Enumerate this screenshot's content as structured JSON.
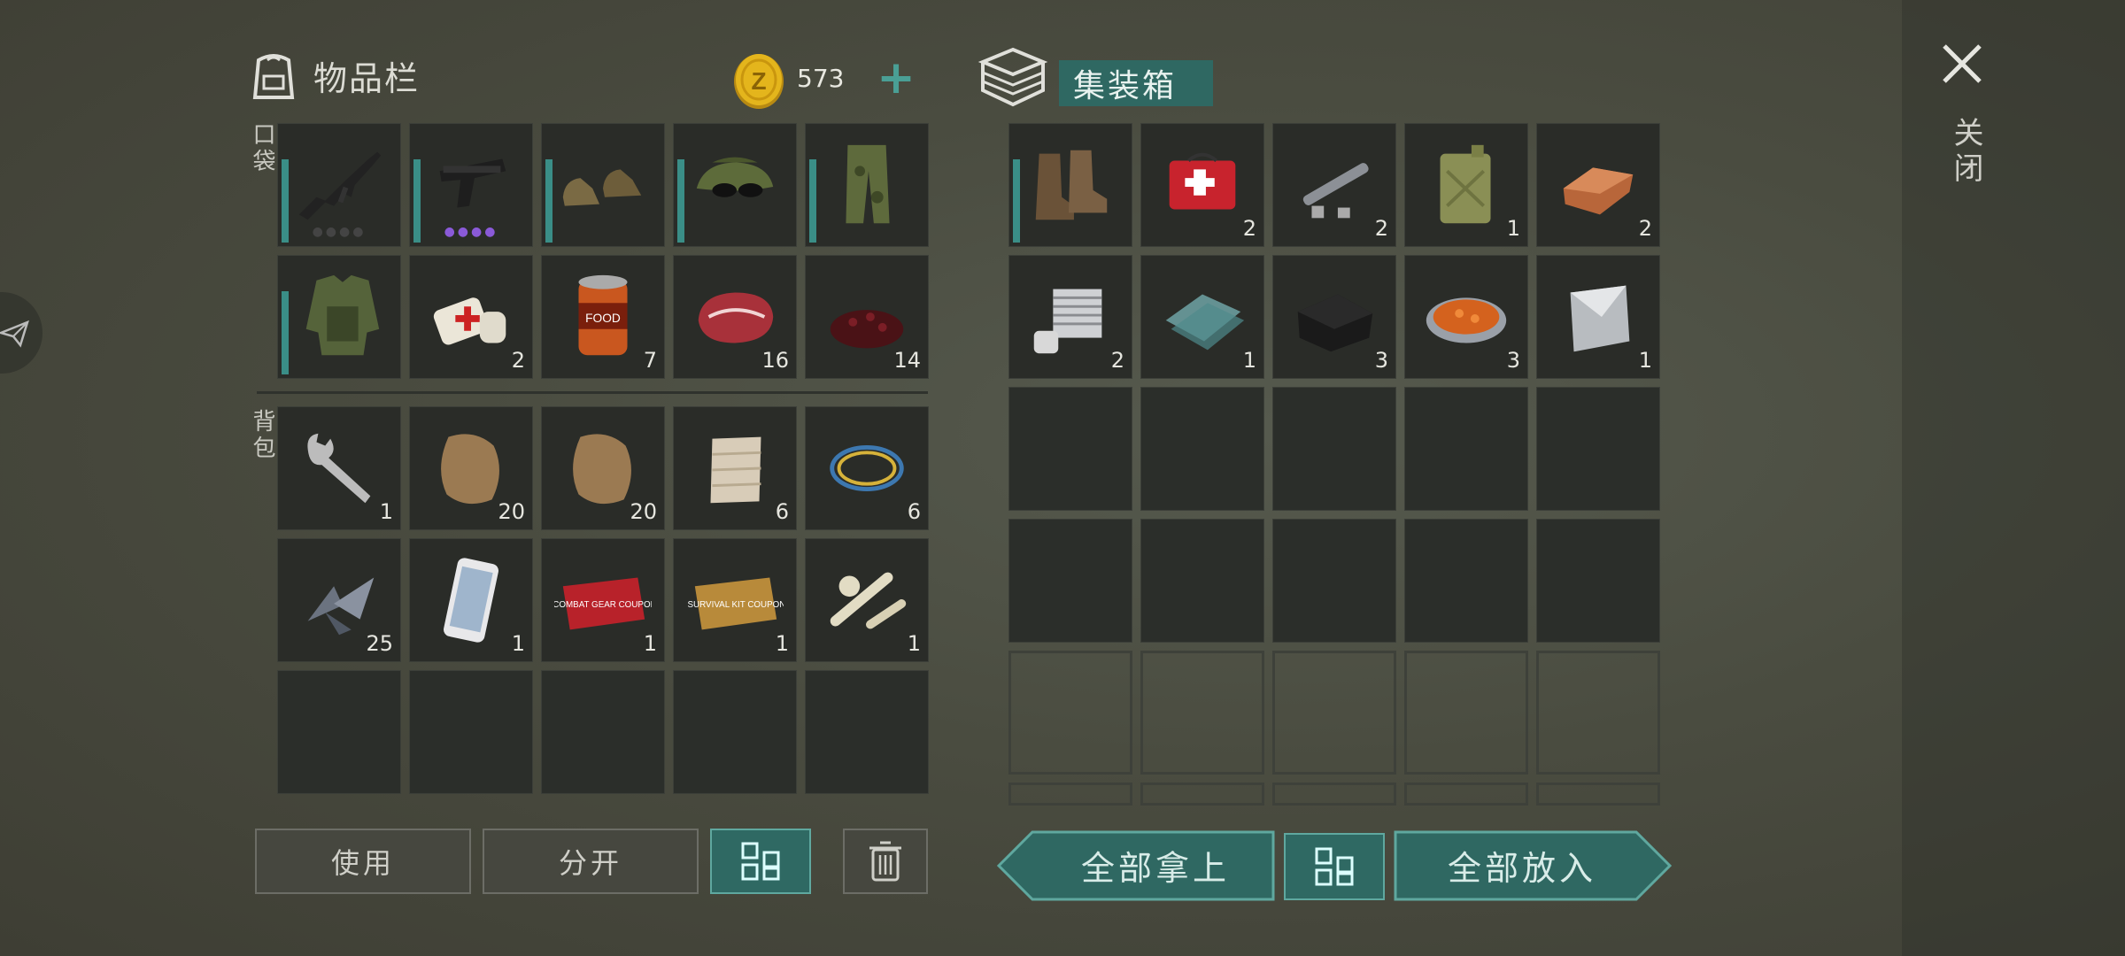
{
  "inventory": {
    "title": "物品栏",
    "coins": "573",
    "pocket_label": "口袋",
    "backpack_label": "背包"
  },
  "container": {
    "title": "集装箱"
  },
  "close_label": "关闭",
  "buttons": {
    "use": "使用",
    "split": "分开",
    "take_all": "全部拿上",
    "put_all": "全部放入"
  },
  "pocket_items": [
    {
      "icon": "assault-rifle",
      "qty": "",
      "bar": true,
      "dots": "grey"
    },
    {
      "icon": "pistol",
      "qty": "",
      "bar": true,
      "dots": "purple"
    },
    {
      "icon": "leather-shoes",
      "qty": "",
      "bar": true
    },
    {
      "icon": "camo-hat-sunglasses",
      "qty": "",
      "bar": true
    },
    {
      "icon": "camo-pants",
      "qty": "",
      "bar": true
    },
    {
      "icon": "camo-jacket",
      "qty": "",
      "bar": true
    },
    {
      "icon": "bandage",
      "qty": "2"
    },
    {
      "icon": "canned-food",
      "qty": "7"
    },
    {
      "icon": "raw-meat",
      "qty": "16"
    },
    {
      "icon": "berries",
      "qty": "14"
    }
  ],
  "backpack_items": [
    {
      "icon": "wrench",
      "qty": "1"
    },
    {
      "icon": "fur-pelt",
      "qty": "20"
    },
    {
      "icon": "fur-pelt",
      "qty": "20"
    },
    {
      "icon": "rope-fabric",
      "qty": "6"
    },
    {
      "icon": "wire-coil",
      "qty": "6"
    },
    {
      "icon": "metal-shards",
      "qty": "25"
    },
    {
      "icon": "smartphone",
      "qty": "1"
    },
    {
      "icon": "combat-gear-coupon",
      "qty": "1",
      "text": "COMBAT GEAR COUPON"
    },
    {
      "icon": "survival-kit-coupon",
      "qty": "1",
      "text": "SURVIVAL KIT COUPON"
    },
    {
      "icon": "bones",
      "qty": "1"
    },
    {
      "icon": "",
      "qty": ""
    },
    {
      "icon": "",
      "qty": ""
    },
    {
      "icon": "",
      "qty": ""
    },
    {
      "icon": "",
      "qty": ""
    },
    {
      "icon": "",
      "qty": ""
    }
  ],
  "container_items": [
    {
      "icon": "boots",
      "qty": "",
      "bar": true
    },
    {
      "icon": "first-aid-kit",
      "qty": "2"
    },
    {
      "icon": "pipe-parts",
      "qty": "2"
    },
    {
      "icon": "jerry-can",
      "qty": "1"
    },
    {
      "icon": "copper-ingot",
      "qty": "2"
    },
    {
      "icon": "engine-cylinder",
      "qty": "2"
    },
    {
      "icon": "glass-sheets",
      "qty": "1"
    },
    {
      "icon": "black-fabric",
      "qty": "3"
    },
    {
      "icon": "stew-bowl",
      "qty": "3"
    },
    {
      "icon": "metal-plate",
      "qty": "1"
    }
  ]
}
